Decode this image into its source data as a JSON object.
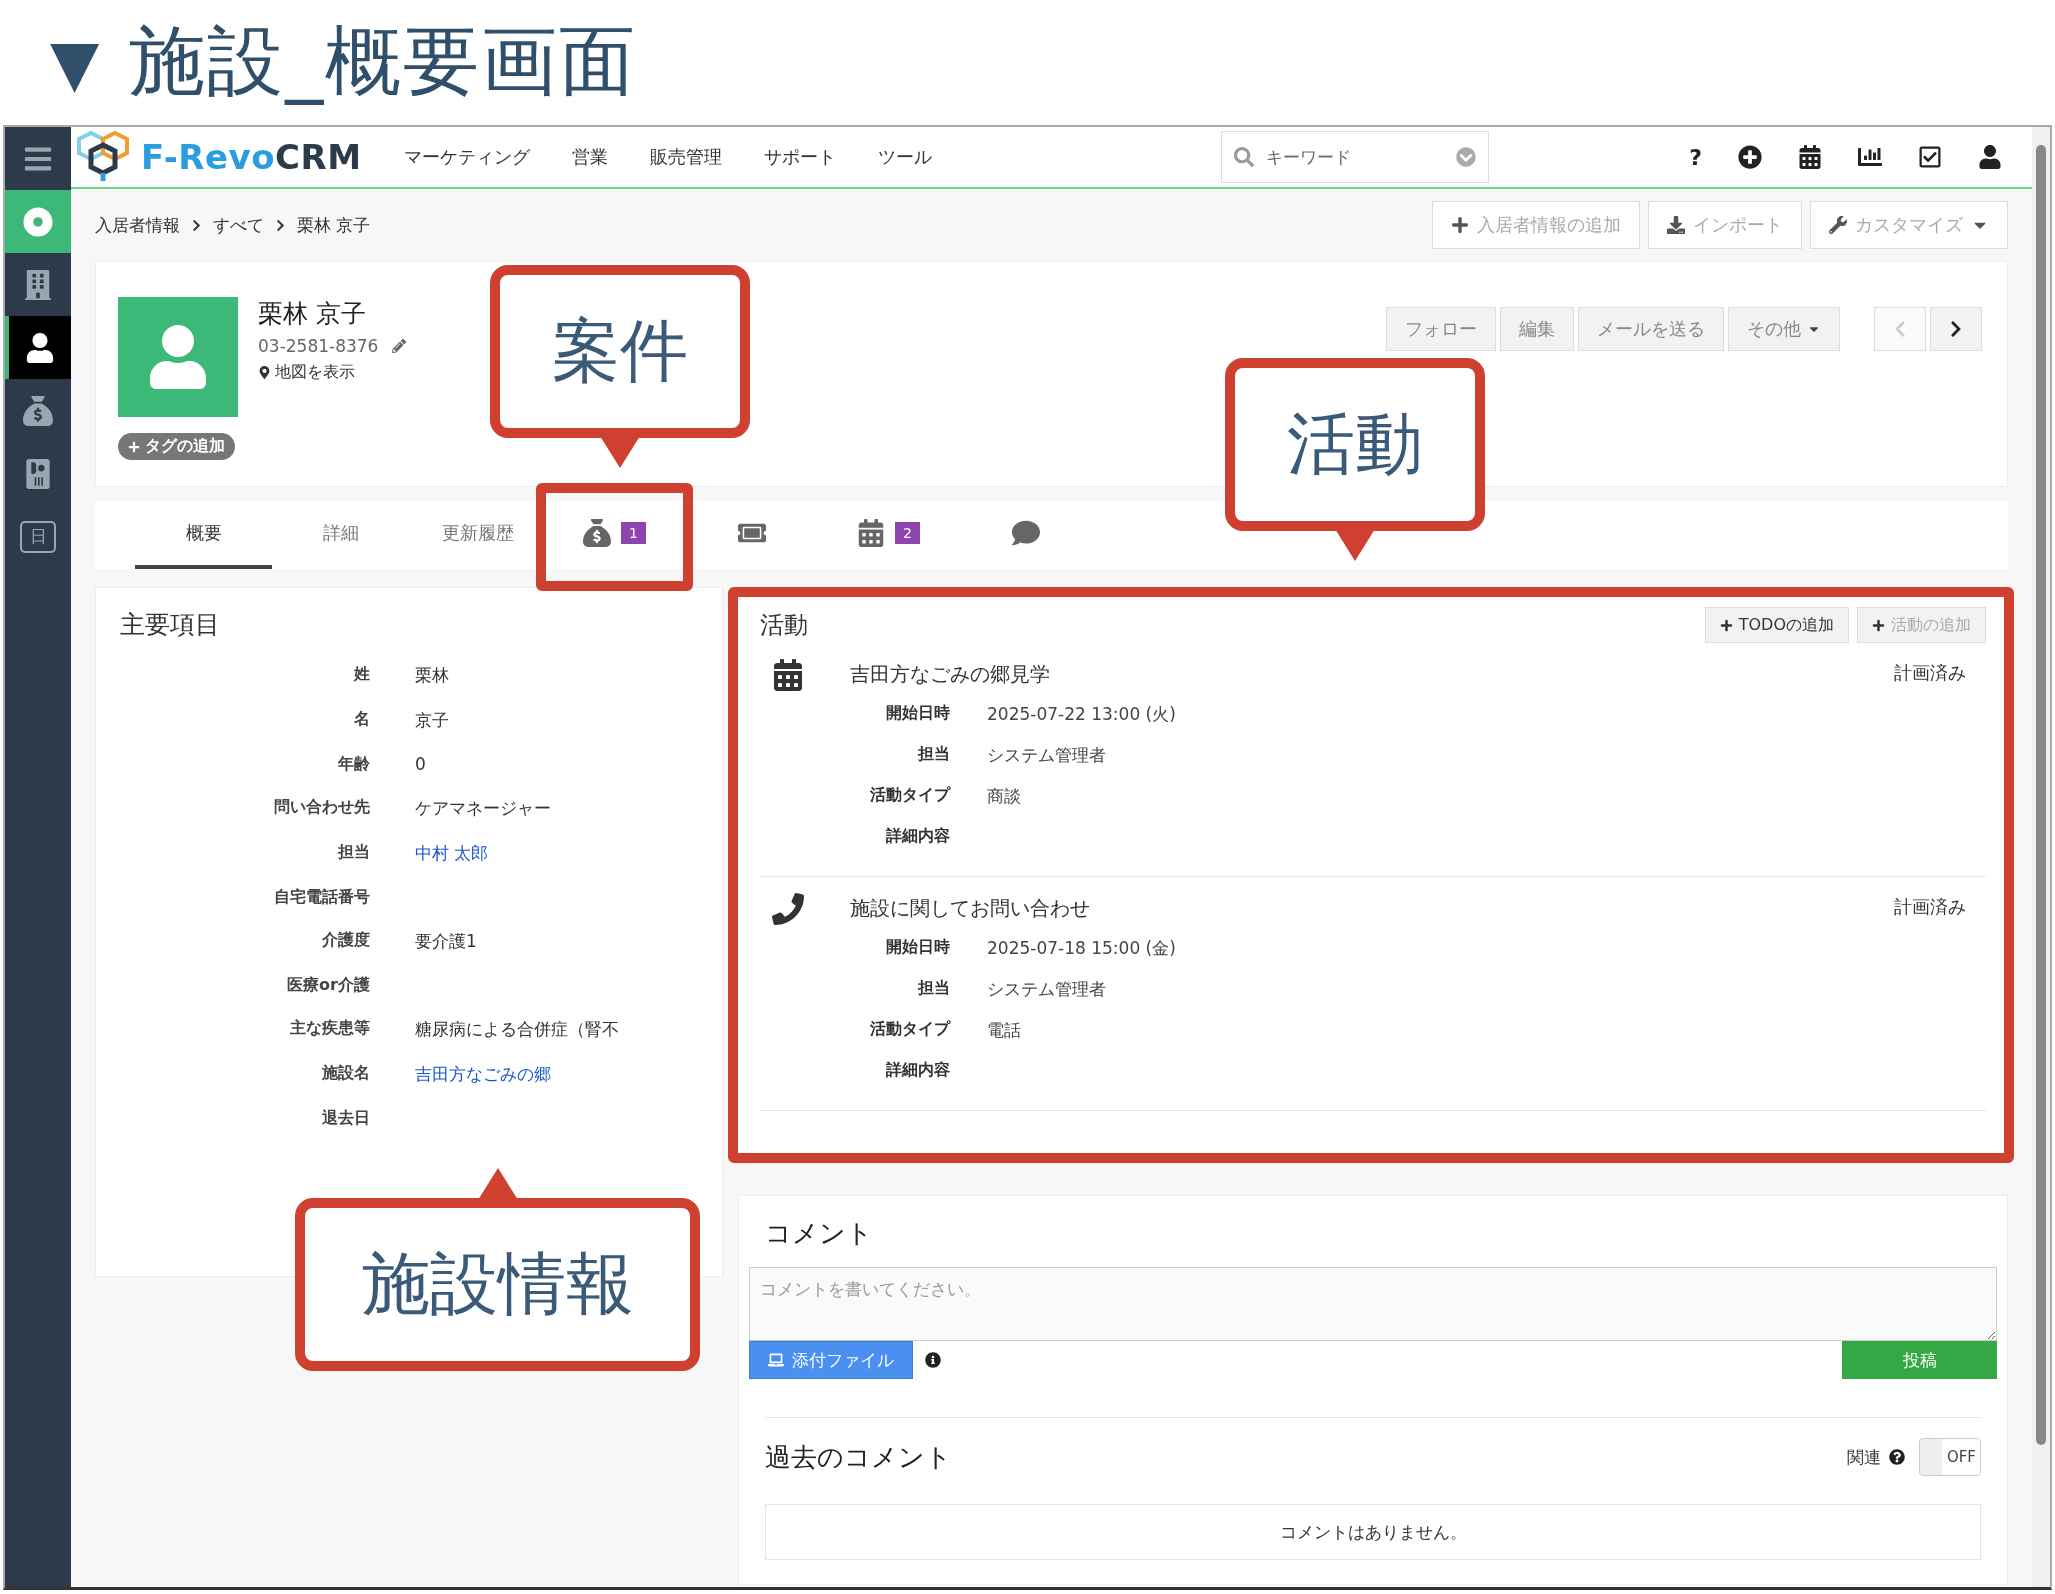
{
  "heading": {
    "marker": "▼",
    "title": "施設_概要画面"
  },
  "topbar": {
    "brand_prefix": "F-Revo",
    "brand_suffix": "CRM",
    "menu": [
      "マーケティング",
      "営業",
      "販売管理",
      "サポート",
      "ツール"
    ],
    "search": {
      "placeholder": "キーワード"
    },
    "help": "?"
  },
  "sidebar": {
    "items": [
      {
        "kind": "home",
        "selected": false
      },
      {
        "kind": "buildings",
        "selected": false
      },
      {
        "kind": "person",
        "selected": true
      },
      {
        "kind": "deals",
        "selected": false
      },
      {
        "kind": "contacts",
        "selected": false
      },
      {
        "kind": "day",
        "label": "日",
        "selected": false
      }
    ]
  },
  "breadcrumb": [
    "入居者情報",
    "すべて",
    "栗林 京子"
  ],
  "page_actions": [
    {
      "kind": "add",
      "label": "入居者情報の追加"
    },
    {
      "kind": "import",
      "label": "インポート"
    },
    {
      "kind": "customize",
      "label": "カスタマイズ"
    }
  ],
  "record": {
    "name": "栗林 京子",
    "phone": "03-2581-8376",
    "map_link": "地図を表示",
    "tag_button": "タグの追加",
    "actions": [
      {
        "label": "フォロー",
        "dropdown": false
      },
      {
        "label": "編集",
        "dropdown": false
      },
      {
        "label": "メールを送る",
        "dropdown": false
      },
      {
        "label": "その他",
        "dropdown": true
      }
    ],
    "pager": {
      "prev_disabled": true,
      "next_disabled": false
    }
  },
  "tabs": [
    {
      "kind": "text",
      "label": "概要",
      "selected": true
    },
    {
      "kind": "text",
      "label": "詳細",
      "selected": false
    },
    {
      "kind": "text",
      "label": "更新履歴",
      "selected": false
    },
    {
      "kind": "deals",
      "count": "1",
      "selected": false
    },
    {
      "kind": "tickets",
      "selected": false
    },
    {
      "kind": "calendar",
      "count": "2",
      "selected": false
    },
    {
      "kind": "comments",
      "selected": false
    }
  ],
  "key_fields": {
    "title": "主要項目",
    "rows": [
      {
        "label": "姓",
        "value": "栗林",
        "link": false
      },
      {
        "label": "名",
        "value": "京子",
        "link": false
      },
      {
        "label": "年齢",
        "value": "0",
        "link": false
      },
      {
        "label": "問い合わせ先",
        "value": "ケアマネージャー",
        "link": false
      },
      {
        "label": "担当",
        "value": "中村 太郎",
        "link": true
      },
      {
        "label": "自宅電話番号"
      },
      {
        "label": "介護度",
        "value": "要介護1",
        "link": false
      },
      {
        "label": "医療or介護"
      },
      {
        "label": "主な疾患等",
        "value": "糖尿病による合併症（腎不",
        "link": false
      },
      {
        "label": "施設名",
        "value": "吉田方なごみの郷",
        "link": true
      },
      {
        "label": "退去日"
      }
    ]
  },
  "activities": {
    "title": "活動",
    "buttons": [
      "TODOの追加",
      "活動の追加"
    ],
    "items": [
      {
        "kind": "event",
        "title": "吉田方なごみの郷見学",
        "status": "計画済み",
        "fields": [
          {
            "label": "開始日時",
            "value": "2025-07-22 13:00 (火)"
          },
          {
            "label": "担当",
            "value": "システム管理者"
          },
          {
            "label": "活動タイプ",
            "value": "商談"
          },
          {
            "label": "詳細内容"
          }
        ]
      },
      {
        "kind": "call",
        "title": "施設に関してお問い合わせ",
        "status": "計画済み",
        "fields": [
          {
            "label": "開始日時",
            "value": "2025-07-18 15:00 (金)"
          },
          {
            "label": "担当",
            "value": "システム管理者"
          },
          {
            "label": "活動タイプ",
            "value": "電話"
          },
          {
            "label": "詳細内容"
          }
        ]
      }
    ]
  },
  "comments": {
    "title": "コメント",
    "placeholder": "コメントを書いてください。",
    "attach": "添付ファイル",
    "post": "投稿",
    "past_title": "過去のコメント",
    "related_label": "関連",
    "toggle": {
      "on": false,
      "label": "OFF"
    },
    "empty": "コメントはありません。"
  },
  "callouts": [
    {
      "label": "案件"
    },
    {
      "label": "活動"
    },
    {
      "label": "施設情報"
    }
  ]
}
